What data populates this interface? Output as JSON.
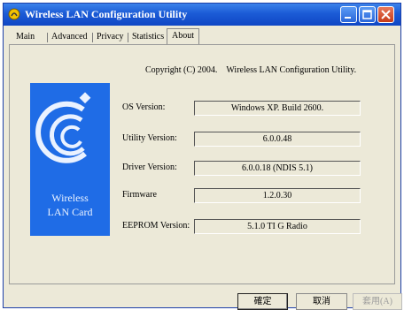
{
  "window": {
    "title": "Wireless LAN Configuration Utility"
  },
  "tabs": [
    "Main",
    "Advanced",
    "Privacy",
    "Statistics",
    "About"
  ],
  "active_tab": "About",
  "about": {
    "copyright": "Copyright (C) 2004.",
    "product": "Wireless LAN Configuration Utility.",
    "card_label_line1": "Wireless",
    "card_label_line2": "LAN Card",
    "rows": [
      {
        "label": "OS Version:",
        "value": "Windows XP. Build 2600."
      },
      {
        "label": "Utility Version:",
        "value": "6.0.0.48"
      },
      {
        "label": "Driver Version:",
        "value": "6.0.0.18 (NDIS 5.1)"
      },
      {
        "label": "Firmware",
        "value": "1.2.0.30"
      },
      {
        "label": "EEPROM Version:",
        "value": "5.1.0    TI G Radio"
      }
    ]
  },
  "buttons": {
    "ok": "確定",
    "cancel": "取消",
    "apply": "套用(A)"
  },
  "colors": {
    "titlebar": "#1b5bd6",
    "card": "#1f6ce6",
    "close_button": "#c63a18"
  }
}
